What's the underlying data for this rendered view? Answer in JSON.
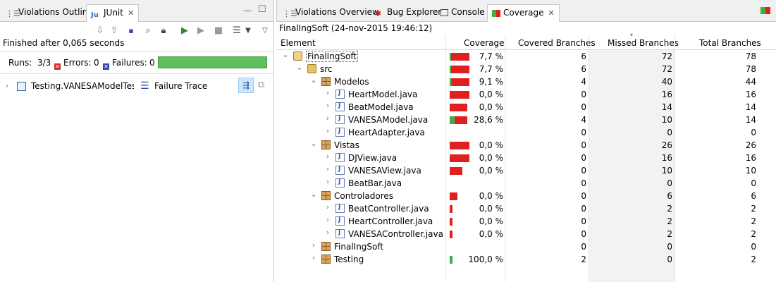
{
  "left": {
    "tabs": [
      {
        "label": "Violations Outline",
        "icon": "violations-outline-icon"
      },
      {
        "label": "JUnit",
        "icon": "junit-icon",
        "active": true
      }
    ],
    "finished": "Finished after 0,065 seconds",
    "runs_label": "Runs:",
    "runs_value": "3/3",
    "errors_label": "Errors:",
    "errors_value": "0",
    "failures_label": "Failures:",
    "failures_value": "0",
    "test_item": "Testing.VANESAModelTest [",
    "failure_trace": "Failure Trace"
  },
  "right": {
    "tabs": [
      {
        "label": "Violations Overview",
        "icon": "violations-overview-icon"
      },
      {
        "label": "Bug Explorer",
        "icon": "bug-icon"
      },
      {
        "label": "Console",
        "icon": "console-icon"
      },
      {
        "label": "Coverage",
        "icon": "coverage-icon",
        "active": true
      }
    ],
    "session_title": "FinalIngSoft (24-nov-2015 19:46:12)",
    "columns": [
      "Element",
      "Coverage",
      "Covered Branches",
      "Missed Branches",
      "Total Branches"
    ],
    "rows": [
      {
        "name": "FinalIngSoft",
        "level": 0,
        "icon": "project",
        "expanded": true,
        "coverage": "7,7 %",
        "covered": "6",
        "missed": "72",
        "total": "78",
        "ratio": 0.077,
        "selected": true
      },
      {
        "name": "src",
        "level": 1,
        "icon": "folder",
        "expanded": true,
        "coverage": "7,7 %",
        "covered": "6",
        "missed": "72",
        "total": "78",
        "ratio": 0.077
      },
      {
        "name": "Modelos",
        "level": 2,
        "icon": "package",
        "expanded": true,
        "coverage": "9,1 %",
        "covered": "4",
        "missed": "40",
        "total": "44",
        "ratio": 0.091
      },
      {
        "name": "HeartModel.java",
        "level": 3,
        "icon": "java",
        "coverage": "0,0 %",
        "covered": "0",
        "missed": "16",
        "total": "16",
        "ratio": 0
      },
      {
        "name": "BeatModel.java",
        "level": 3,
        "icon": "java",
        "coverage": "0,0 %",
        "covered": "0",
        "missed": "14",
        "total": "14",
        "ratio": 0
      },
      {
        "name": "VANESAModel.java",
        "level": 3,
        "icon": "java",
        "coverage": "28,6 %",
        "covered": "4",
        "missed": "10",
        "total": "14",
        "ratio": 0.286
      },
      {
        "name": "HeartAdapter.java",
        "level": 3,
        "icon": "java",
        "coverage": "",
        "covered": "0",
        "missed": "0",
        "total": "0",
        "ratio": null
      },
      {
        "name": "Vistas",
        "level": 2,
        "icon": "package",
        "expanded": true,
        "coverage": "0,0 %",
        "covered": "0",
        "missed": "26",
        "total": "26",
        "ratio": 0
      },
      {
        "name": "DJView.java",
        "level": 3,
        "icon": "java",
        "coverage": "0,0 %",
        "covered": "0",
        "missed": "16",
        "total": "16",
        "ratio": 0
      },
      {
        "name": "VANESAView.java",
        "level": 3,
        "icon": "java",
        "coverage": "0,0 %",
        "covered": "0",
        "missed": "10",
        "total": "10",
        "ratio": 0
      },
      {
        "name": "BeatBar.java",
        "level": 3,
        "icon": "java",
        "coverage": "",
        "covered": "0",
        "missed": "0",
        "total": "0",
        "ratio": null
      },
      {
        "name": "Controladores",
        "level": 2,
        "icon": "package",
        "expanded": true,
        "coverage": "0,0 %",
        "covered": "0",
        "missed": "6",
        "total": "6",
        "ratio": 0
      },
      {
        "name": "BeatController.java",
        "level": 3,
        "icon": "java",
        "coverage": "0,0 %",
        "covered": "0",
        "missed": "2",
        "total": "2",
        "ratio": 0
      },
      {
        "name": "HeartController.java",
        "level": 3,
        "icon": "java",
        "coverage": "0,0 %",
        "covered": "0",
        "missed": "2",
        "total": "2",
        "ratio": 0
      },
      {
        "name": "VANESAController.java",
        "level": 3,
        "icon": "java",
        "coverage": "0,0 %",
        "covered": "0",
        "missed": "2",
        "total": "2",
        "ratio": 0
      },
      {
        "name": "FinalIngSoft",
        "level": 2,
        "icon": "package",
        "expanded": false,
        "coverage": "",
        "covered": "0",
        "missed": "0",
        "total": "0",
        "ratio": null
      },
      {
        "name": "Testing",
        "level": 2,
        "icon": "package",
        "expanded": false,
        "coverage": "100,0 %",
        "covered": "2",
        "missed": "0",
        "total": "2",
        "ratio": 1.0
      }
    ]
  },
  "colors": {
    "covered": "#3cb043",
    "missed": "#e02020",
    "junit_ok": "#5fbf5f",
    "selection": "#cce8ff"
  }
}
